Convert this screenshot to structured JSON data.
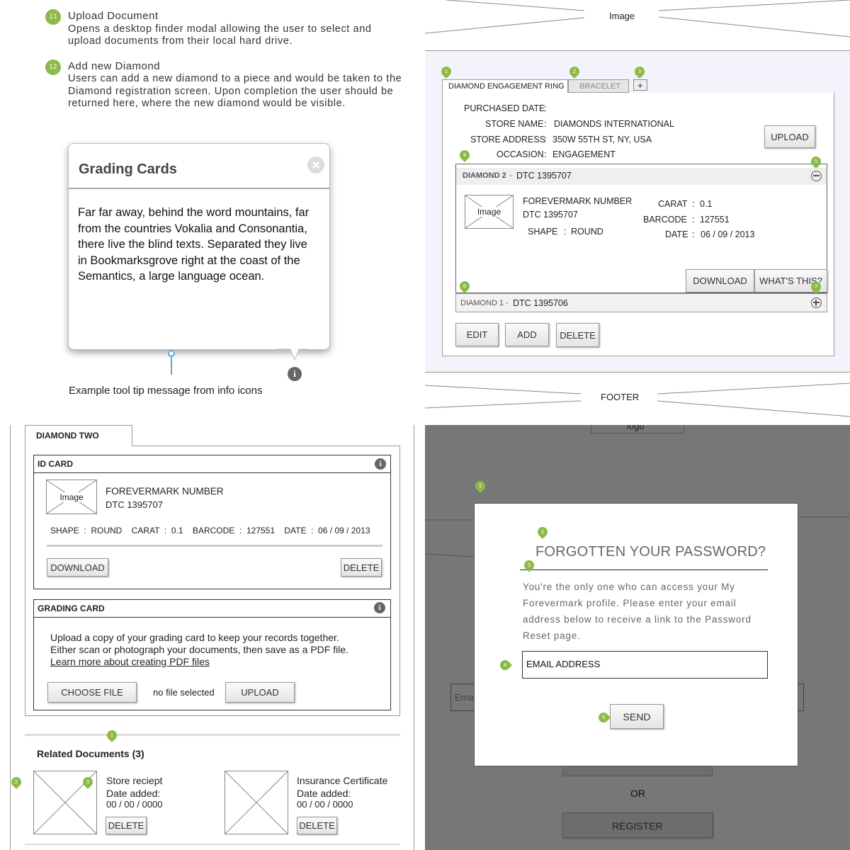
{
  "q1": {
    "item11": {
      "num": "11",
      "title": "Upload Document",
      "desc": "Opens a desktop finder modal allowing the user to select and upload documents from their local hard drive."
    },
    "item12": {
      "num": "12",
      "title": "Add new Diamond",
      "desc": "Users can add a new diamond to a piece and would be taken to the Diamond registration screen. Upon completion the user should be returned here, where the new diamond would be visible."
    },
    "tooltip": {
      "title": "Grading Cards",
      "body": "Far far away, behind the word mountains, far from the countries Vokalia and Consonantia, there live the blind texts. Separated they live in Bookmarksgrove right at the coast of the Semantics, a large language ocean."
    },
    "info_glyph": "i",
    "caption": "Example tool tip message from info icons"
  },
  "q2": {
    "header_image": "Image",
    "footer": "FOOTER",
    "badges": [
      "1",
      "2",
      "3",
      "4",
      "5",
      "6",
      "7"
    ],
    "tabs": [
      "DIAMOND ENGAGEMENT RING",
      "BRACELET",
      "+"
    ],
    "fields": [
      {
        "label": "PURCHASED DATE",
        "sep": ":",
        "value": ""
      },
      {
        "label": "STORE NAME",
        "sep": ":",
        "value": "DIAMONDS INTERNATIONAL"
      },
      {
        "label": "STORE ADDRESS",
        "sep": ":",
        "value": "350W 55TH ST, NY, USA"
      },
      {
        "label": "OCCASION",
        "sep": ":",
        "value": "ENGAGEMENT"
      }
    ],
    "upload": "UPLOAD",
    "diamond2": {
      "name": "DIAMOND 2",
      "sep": "-",
      "code": "DTC 1395707",
      "image": "Image",
      "fm_label": "FOREVERMARK NUMBER",
      "fm_value": "DTC 1395707",
      "shape_label": "SHAPE",
      "shape_value": "ROUND",
      "carat_label": "CARAT",
      "carat_value": "0.1",
      "barcode_label": "BARCODE",
      "barcode_value": "127551",
      "date_label": "DATE",
      "date_value": "06 / 09 / 2013",
      "colon": ":"
    },
    "download": "DOWNLOAD",
    "whats_this": "WHAT'S THIS?",
    "diamond1": {
      "name": "DIAMOND 1",
      "sep": "-",
      "code": "DTC 1395706"
    },
    "edit": "EDIT",
    "add": "ADD",
    "delete": "DELETE"
  },
  "q3": {
    "tab": "DIAMOND TWO",
    "id_card": {
      "title": "ID CARD",
      "image": "Image",
      "fm_label": "FOREVERMARK NUMBER",
      "fm_value": "DTC 1395707",
      "specs": "SHAPE  :  ROUND    CARAT  :  0.1    BARCODE  :  127551    DATE  :  06 / 09 / 2013",
      "download": "DOWNLOAD",
      "delete": "DELETE"
    },
    "grading_card": {
      "title": "GRADING CARD",
      "line1": "Upload a copy of your grading card to keep your records together.",
      "line2": "Either scan or photograph your documents, then save as a PDF file.",
      "link": "Learn more about creating PDF files",
      "choose": "CHOOSE FILE",
      "no_file": "no file selected",
      "upload": "UPLOAD"
    },
    "related": {
      "title": "Related Documents (3)",
      "badges": [
        "1",
        "2",
        "3"
      ],
      "docs": [
        {
          "name": "Store reciept",
          "added": "Date added:",
          "date": "00 / 00 / 0000",
          "delete": "DELETE"
        },
        {
          "name": "Insurance Certificate",
          "added": "Date added:",
          "date": "00 / 00 / 0000",
          "delete": "DELETE"
        }
      ]
    }
  },
  "q4": {
    "bg_logo": "logo",
    "bg_email": "Email",
    "bg_or": "OR",
    "bg_register": "REGISTER",
    "badges": [
      "1",
      "2",
      "3",
      "4",
      "5"
    ],
    "modal": {
      "title": "FORGOTTEN YOUR PASSWORD?",
      "body": "You're the only one who can access your My Forevermark profile. Please enter your email address below to receive a link to the Password Reset page.",
      "input_placeholder": "EMAIL ADDRESS",
      "send": "SEND"
    },
    "overlay_color": "#777777"
  },
  "colors": {
    "badge_green": "#8cba4a",
    "link_blue": "#5aa9d6"
  }
}
